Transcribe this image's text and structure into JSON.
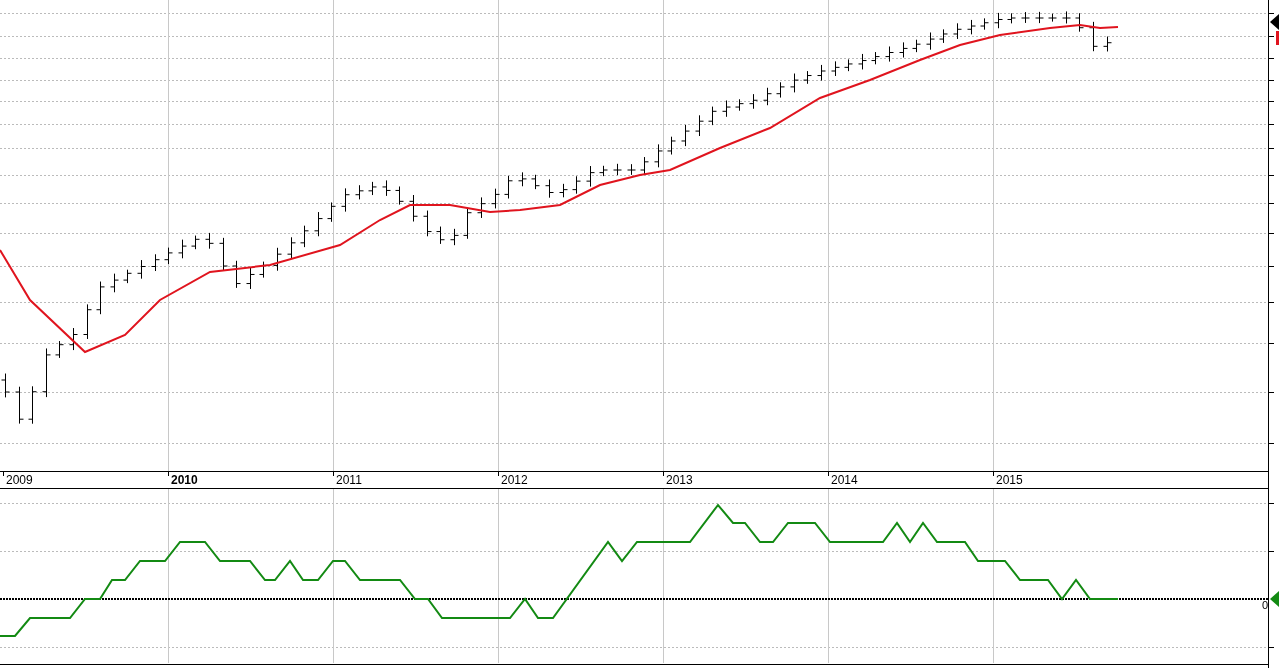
{
  "time_axis": {
    "labels": [
      {
        "text": "2009",
        "bold": false
      },
      {
        "text": "2010",
        "bold": true
      },
      {
        "text": "2011",
        "bold": false
      },
      {
        "text": "2012",
        "bold": false
      },
      {
        "text": "2013",
        "bold": false
      },
      {
        "text": "2014",
        "bold": false
      },
      {
        "text": "2015",
        "bold": false
      }
    ]
  },
  "indicator_panel": {
    "zero_label": "0"
  }
}
